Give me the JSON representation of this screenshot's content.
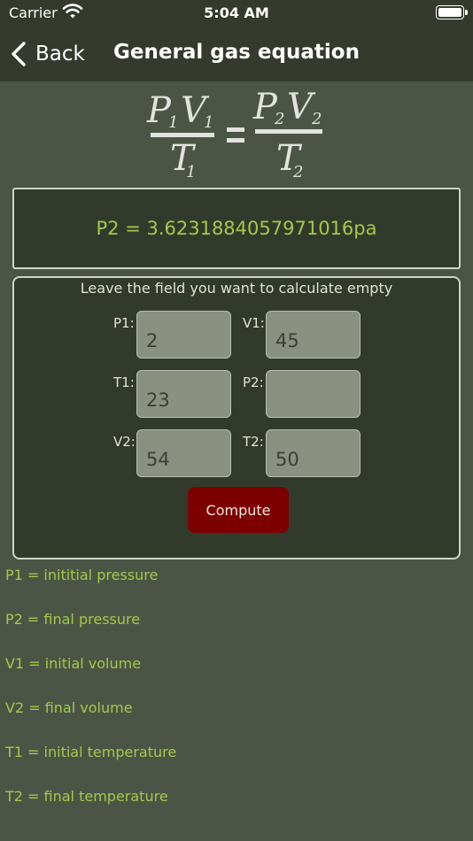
{
  "status_bar": {
    "carrier": "Carrier",
    "time": "5:04 AM"
  },
  "nav": {
    "back_label": "Back",
    "title": "General gas equation"
  },
  "result": {
    "text": "P2 = 3.6231884057971016pa"
  },
  "form": {
    "hint": "Leave the field you want to calculate empty",
    "p1": {
      "label": "P1:",
      "value": "2"
    },
    "v1": {
      "label": "V1:",
      "value": "45"
    },
    "t1": {
      "label": "T1:",
      "value": "23"
    },
    "p2": {
      "label": "P2:",
      "value": ""
    },
    "v2": {
      "label": "V2:",
      "value": "54"
    },
    "t2": {
      "label": "T2:",
      "value": "50"
    },
    "compute_label": "Compute"
  },
  "definitions": [
    "P1 = inititial pressure",
    "P2 = final pressure",
    "V1 = initial volume",
    "V2 = final volume",
    "T1 = initial temperature",
    "T2 = final temperature"
  ],
  "colors": {
    "accent_green": "#a3c94b",
    "compute_red": "#7d0000",
    "background": "#4c5545",
    "bar": "#343a2d"
  }
}
